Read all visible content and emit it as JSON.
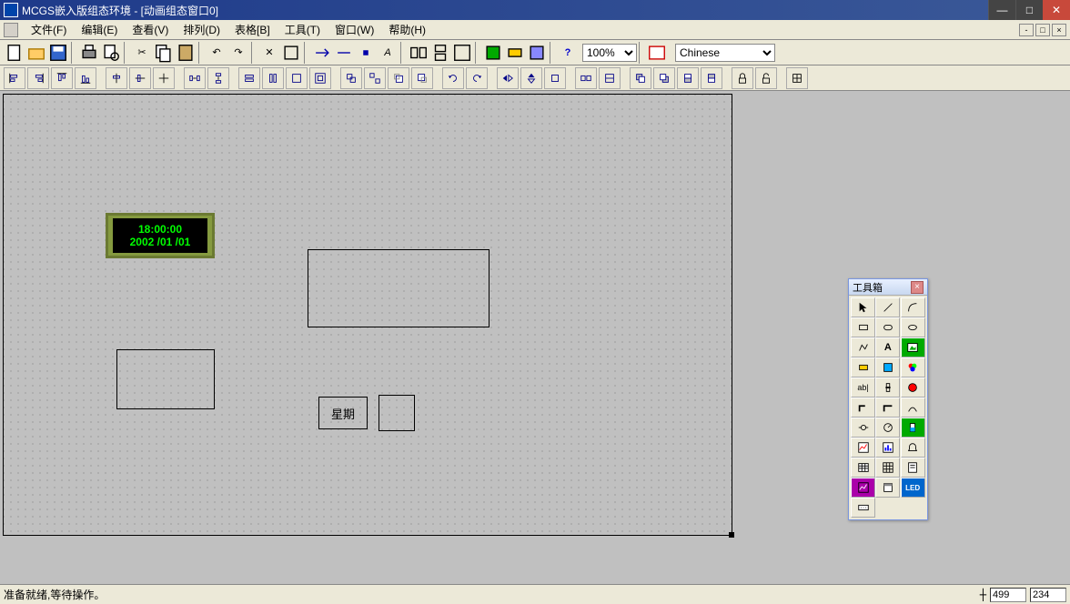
{
  "title": "MCGS嵌入版组态环境 - [动画组态窗口0]",
  "menu": {
    "file": "文件(F)",
    "edit": "编辑(E)",
    "view": "查看(V)",
    "arrange": "排列(D)",
    "table": "表格[B]",
    "tool": "工具(T)",
    "window": "窗口(W)",
    "help": "帮助(H)"
  },
  "zoom": "100%",
  "language": "Chinese",
  "clock": {
    "time": "18:00:00",
    "date": "2002 /01 /01"
  },
  "canvas": {
    "weekday_label": "星期"
  },
  "toolbox": {
    "title": "工具箱"
  },
  "status": {
    "message": "准备就绪,等待操作。",
    "x": "499",
    "y": "234"
  }
}
